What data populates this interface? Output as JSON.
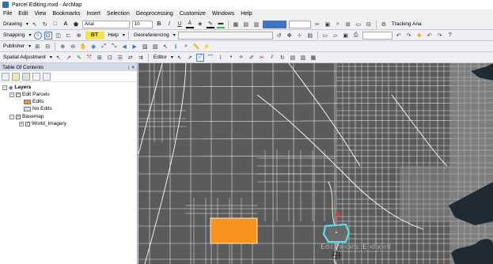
{
  "window": {
    "title": "Parcel Editing.mxd - ArcMap"
  },
  "menu": [
    "File",
    "Edit",
    "View",
    "Bookmarks",
    "Insert",
    "Selection",
    "Geoprocessing",
    "Customize",
    "Windows",
    "Help"
  ],
  "toolbar1": {
    "drawing_label": "Drawing",
    "font_name": "Arial",
    "font_size": "10",
    "bold": "B",
    "italic": "I",
    "underline": "U",
    "text_tool": "A",
    "tracking_label": "Tracking Ana"
  },
  "toolbar2": {
    "snapping_label": "Snapping",
    "bt_label": "BT",
    "help_label": "Help",
    "georeferencing_label": "Georeferencing"
  },
  "toolbar3": {
    "publisher_label": "Publisher",
    "spatial_adjustment_label": "Spatial Adjustment",
    "editor_label": "Editor"
  },
  "toc": {
    "title": "Table Of Contents",
    "pin": "↓",
    "close": "×",
    "layers_label": "Layers",
    "edit_parcels_label": "Edit Parcels",
    "edits_label": "Edits",
    "no_edits_label": "No Edits",
    "basemap_label": "Basemap",
    "world_imagery_label": "World_Imagery"
  },
  "colors": {
    "edits": "#f7931e",
    "no_edits": "#d9d9d9",
    "map_background": "#5b5b5b",
    "street": "#e6e6e6",
    "selection": "#58e0e6",
    "water": "#1f2a33"
  },
  "map": {
    "snap_tip": "Edit Parcels: Endpoint"
  }
}
